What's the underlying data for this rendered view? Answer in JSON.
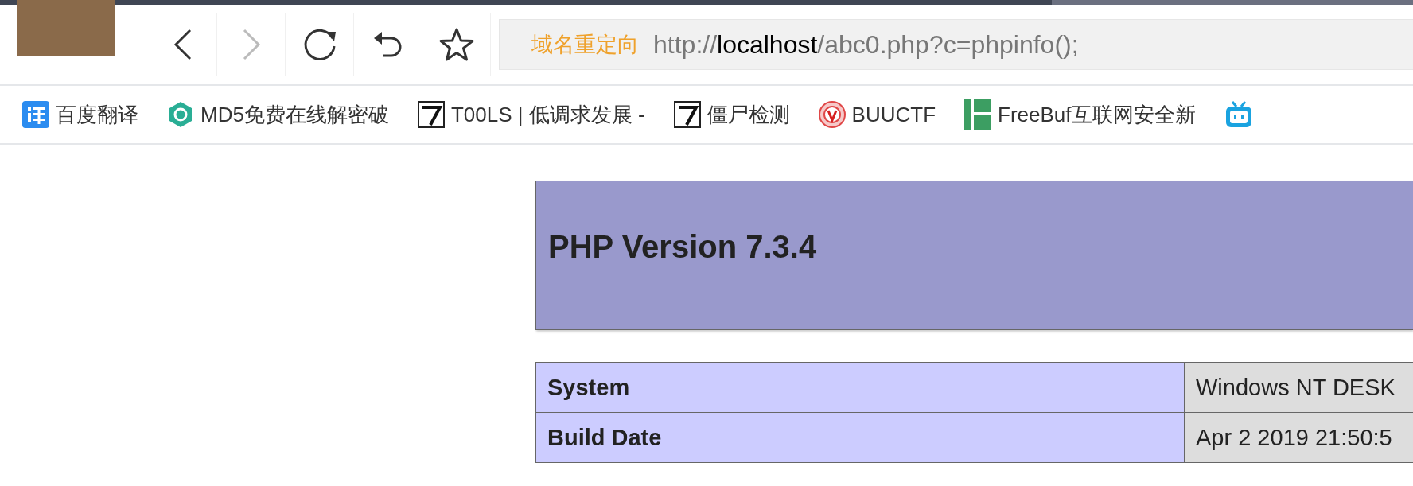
{
  "toolbar": {
    "back": {
      "disabled": false
    },
    "forward": {
      "disabled": true
    }
  },
  "address_bar": {
    "badge": "域名重定向",
    "url_scheme": "http://",
    "url_host": "localhost",
    "url_path": "/abc0.php?c=phpinfo();"
  },
  "bookmarks": [
    {
      "kind": "translate",
      "label": "百度翻译"
    },
    {
      "kind": "md5",
      "label": "MD5免费在线解密破"
    },
    {
      "kind": "seven",
      "label": "T00LS | 低调求发展 -"
    },
    {
      "kind": "seven",
      "label": "僵尸检测"
    },
    {
      "kind": "seal",
      "label": "BUUCTF"
    },
    {
      "kind": "freebuf",
      "label": "FreeBuf互联网安全新"
    },
    {
      "kind": "tv"
    }
  ],
  "page": {
    "title": "PHP Version 7.3.4",
    "rows": [
      {
        "name": "System",
        "value": "Windows NT DESK"
      },
      {
        "name": "Build Date",
        "value": "Apr 2 2019 21:50:5"
      }
    ]
  }
}
